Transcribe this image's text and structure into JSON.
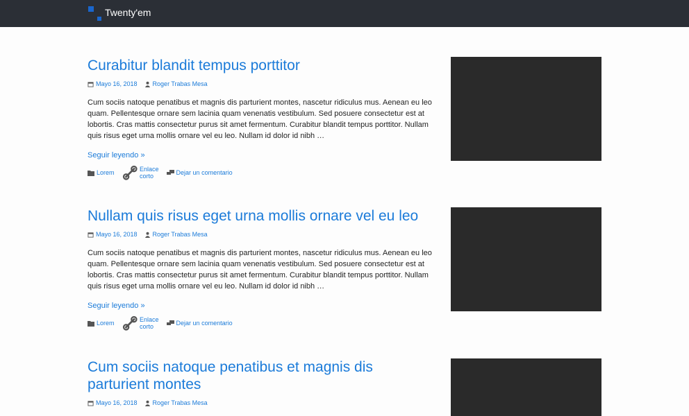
{
  "site": {
    "title": "Twenty'em"
  },
  "posts": [
    {
      "title": "Curabitur blandit tempus porttitor",
      "date": "Mayo 16, 2018",
      "author": "Roger Trabas Mesa",
      "excerpt": "Cum sociis natoque penatibus et magnis dis parturient montes, nascetur ridiculus mus. Aenean eu leo quam. Pellentesque ornare sem lacinia quam venenatis vestibulum. Sed posuere consectetur est at lobortis. Cras mattis consectetur purus sit amet fermentum. Curabitur blandit tempus porttitor. Nullam quis risus eget urna mollis ornare vel eu leo. Nullam id dolor id nibh …",
      "read_more": "Seguir leyendo »",
      "category": "Lorem",
      "shortlink": "Enlace corto",
      "comment": "Dejar un comentario"
    },
    {
      "title": "Nullam quis risus eget urna mollis ornare vel eu leo",
      "date": "Mayo 16, 2018",
      "author": "Roger Trabas Mesa",
      "excerpt": "Cum sociis natoque penatibus et magnis dis parturient montes, nascetur ridiculus mus. Aenean eu leo quam. Pellentesque ornare sem lacinia quam venenatis vestibulum. Sed posuere consectetur est at lobortis. Cras mattis consectetur purus sit amet fermentum. Curabitur blandit tempus porttitor. Nullam quis risus eget urna mollis ornare vel eu leo. Nullam id dolor id nibh …",
      "read_more": "Seguir leyendo »",
      "category": "Lorem",
      "shortlink": "Enlace corto",
      "comment": "Dejar un comentario"
    },
    {
      "title": "Cum sociis natoque penatibus et magnis dis parturient montes",
      "date": "Mayo 16, 2018",
      "author": "Roger Trabas Mesa"
    }
  ],
  "icons": {
    "calendar": "calendar-icon",
    "author": "user-icon",
    "category": "folder-icon",
    "shortlink": "link-icon",
    "comment": "comments-icon"
  },
  "colors": {
    "topbar": "#2b2f36",
    "accent": "#1b7bd9",
    "logo": "#1a66cc",
    "thumbnail": "#2a2a2a"
  }
}
